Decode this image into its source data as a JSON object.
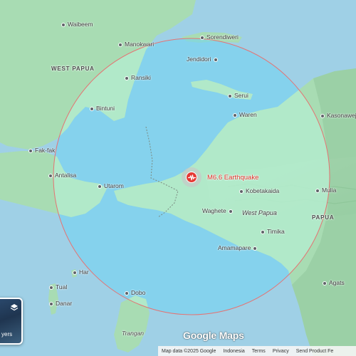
{
  "map": {
    "type": "Google Maps",
    "region_labels": {
      "west_papua": "WEST PAPUA",
      "papua": "PAPUA"
    },
    "province_label": "West Papua",
    "places": {
      "waibeem": "Waibeem",
      "manokwari": "Manokwari",
      "sorendiweri": "Sorendiweri",
      "jendidori": "Jendidori",
      "ransiki": "Ransiki",
      "serui": "Serui",
      "bintuni": "Bintuni",
      "waren": "Waren",
      "kasonaweja": "Kasonaweja",
      "fakfak": "Fak-fak",
      "antalisa": "Antalisa",
      "utarom": "Utarom",
      "kobetakaida": "Kobetakaida",
      "mulia": "Mulia",
      "waghete": "Waghete",
      "timika": "Timika",
      "amamapare": "Amamapare",
      "har": "Har",
      "tual": "Tual",
      "danar": "Danar",
      "dobo": "Dobo",
      "agats": "Agats",
      "trangan": "Trangan"
    },
    "earthquake": {
      "label": "M6.6 Earthquake",
      "icon": "seismic-wave-icon",
      "marker_color": "#e53935",
      "circle_stroke": "#e57373"
    },
    "layers_button": {
      "label": "yers",
      "icon": "layers-icon"
    },
    "logo": "Google Maps",
    "footer": {
      "map_data": "Map data ©2025 Google",
      "country": "Indonesia",
      "terms": "Terms",
      "privacy": "Privacy",
      "feedback": "Send Product Fe"
    },
    "colors": {
      "sea": "#9fd0e6",
      "land": "#a8dcb3",
      "circle_fill": "#6fd4f2",
      "accent_red": "#d93025"
    }
  }
}
